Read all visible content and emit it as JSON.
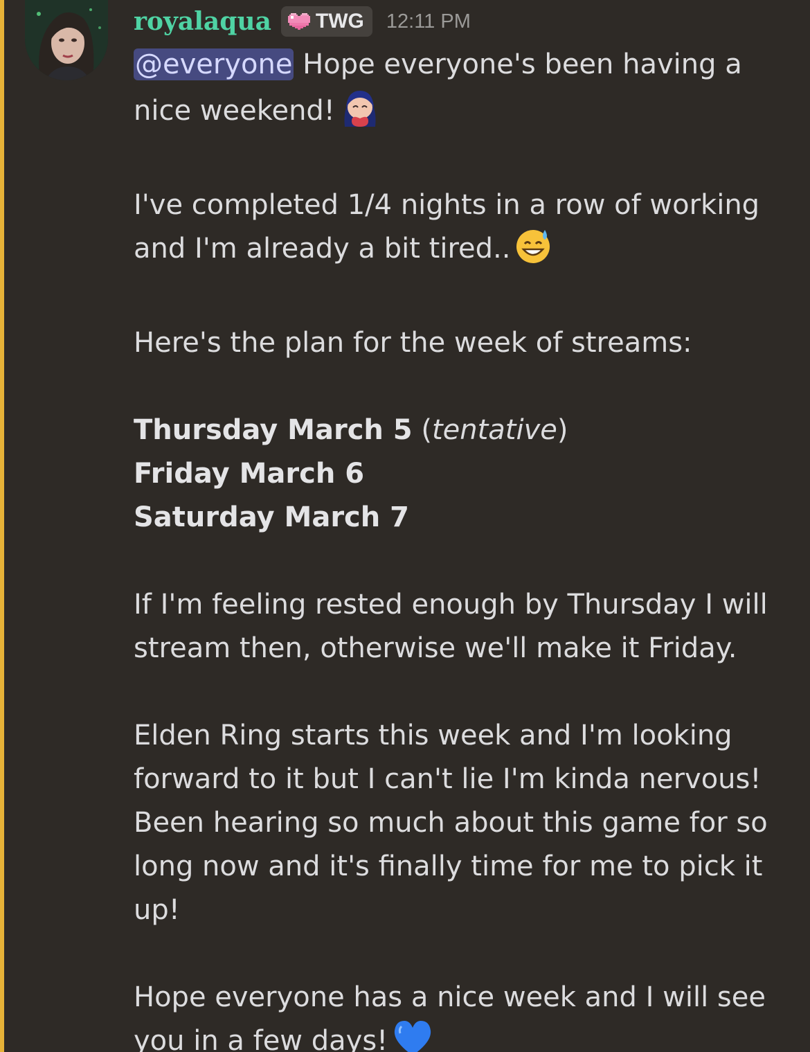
{
  "message": {
    "author": "royalaqua",
    "tag": "TWG",
    "tag_icon": "pixel-heart-icon",
    "timestamp": "12:11 PM",
    "mention": "@everyone",
    "line1_rest": " Hope everyone's been having a",
    "line2": "nice weekend!",
    "para2": "I've completed 1/4 nights in a row of working and I'm already a bit tired..",
    "para3": "Here's the plan for the week of streams:",
    "schedule": [
      {
        "day": "Thursday March 5",
        "note_open": " (",
        "note": "tentative",
        "note_close": ")"
      },
      {
        "day": "Friday March 6"
      },
      {
        "day": "Saturday March 7"
      }
    ],
    "para5": "If I'm feeling rested enough by Thursday I will stream then, otherwise we'll make it Friday.",
    "para6": "Elden Ring starts this week and I'm looking forward to it but I can't lie I'm kinda nervous! Been hearing so much about this game for so long now and it's finally time for me to pick it up!",
    "para7": "Hope everyone has a nice week and I will see you in a few days!",
    "emojis": [
      "hugging-heart-emote-icon",
      "sweat-smile-emoji-icon",
      "blue-heart-emoji-icon"
    ]
  },
  "colors": {
    "background": "#2e2a26",
    "highlight_bar": "#e6b238",
    "username": "#4fd3a4",
    "mention_bg": "#464a80",
    "timestamp": "#9b9a98"
  }
}
